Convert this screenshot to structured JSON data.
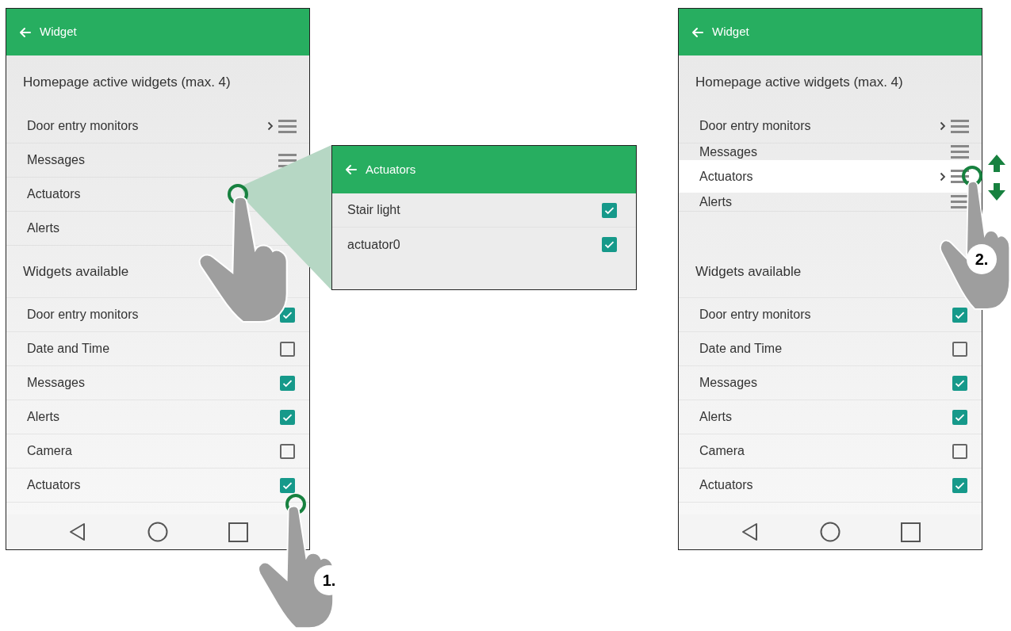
{
  "screens": [
    {
      "title": "Widget",
      "active_heading": "Homepage active widgets (max. 4)",
      "active_widgets": [
        {
          "label": "Door entry monitors",
          "chevron": true
        },
        {
          "label": "Messages",
          "chevron": false
        },
        {
          "label": "Actuators",
          "chevron": false,
          "handle_hidden": true
        },
        {
          "label": "Alerts",
          "chevron": false,
          "handle_hidden": true
        }
      ],
      "available_heading": "Widgets available",
      "available_widgets": [
        {
          "label": "Door entry monitors",
          "checked": true
        },
        {
          "label": "Date and Time",
          "checked": false
        },
        {
          "label": "Messages",
          "checked": true
        },
        {
          "label": "Alerts",
          "checked": true
        },
        {
          "label": "Camera",
          "checked": false
        },
        {
          "label": "Actuators",
          "checked": true
        }
      ]
    },
    {
      "title": "Widget",
      "active_heading": "Homepage active widgets (max. 4)",
      "active_widgets": [
        {
          "label": "Door entry monitors",
          "chevron": true
        },
        {
          "label": "Messages",
          "chevron": false
        },
        {
          "label": "Alerts",
          "chevron": false
        }
      ],
      "dragged_widget": {
        "label": "Actuators",
        "chevron": true
      },
      "available_heading": "Widgets available",
      "available_widgets": [
        {
          "label": "Door entry monitors",
          "checked": true
        },
        {
          "label": "Date and Time",
          "checked": false
        },
        {
          "label": "Messages",
          "checked": true
        },
        {
          "label": "Alerts",
          "checked": true
        },
        {
          "label": "Camera",
          "checked": false
        },
        {
          "label": "Actuators",
          "checked": true
        }
      ]
    }
  ],
  "detail_screen": {
    "title": "Actuators",
    "items": [
      {
        "label": "Stair light",
        "checked": true
      },
      {
        "label": "actuator0",
        "checked": true
      }
    ]
  },
  "steps": [
    "1.",
    "2."
  ]
}
